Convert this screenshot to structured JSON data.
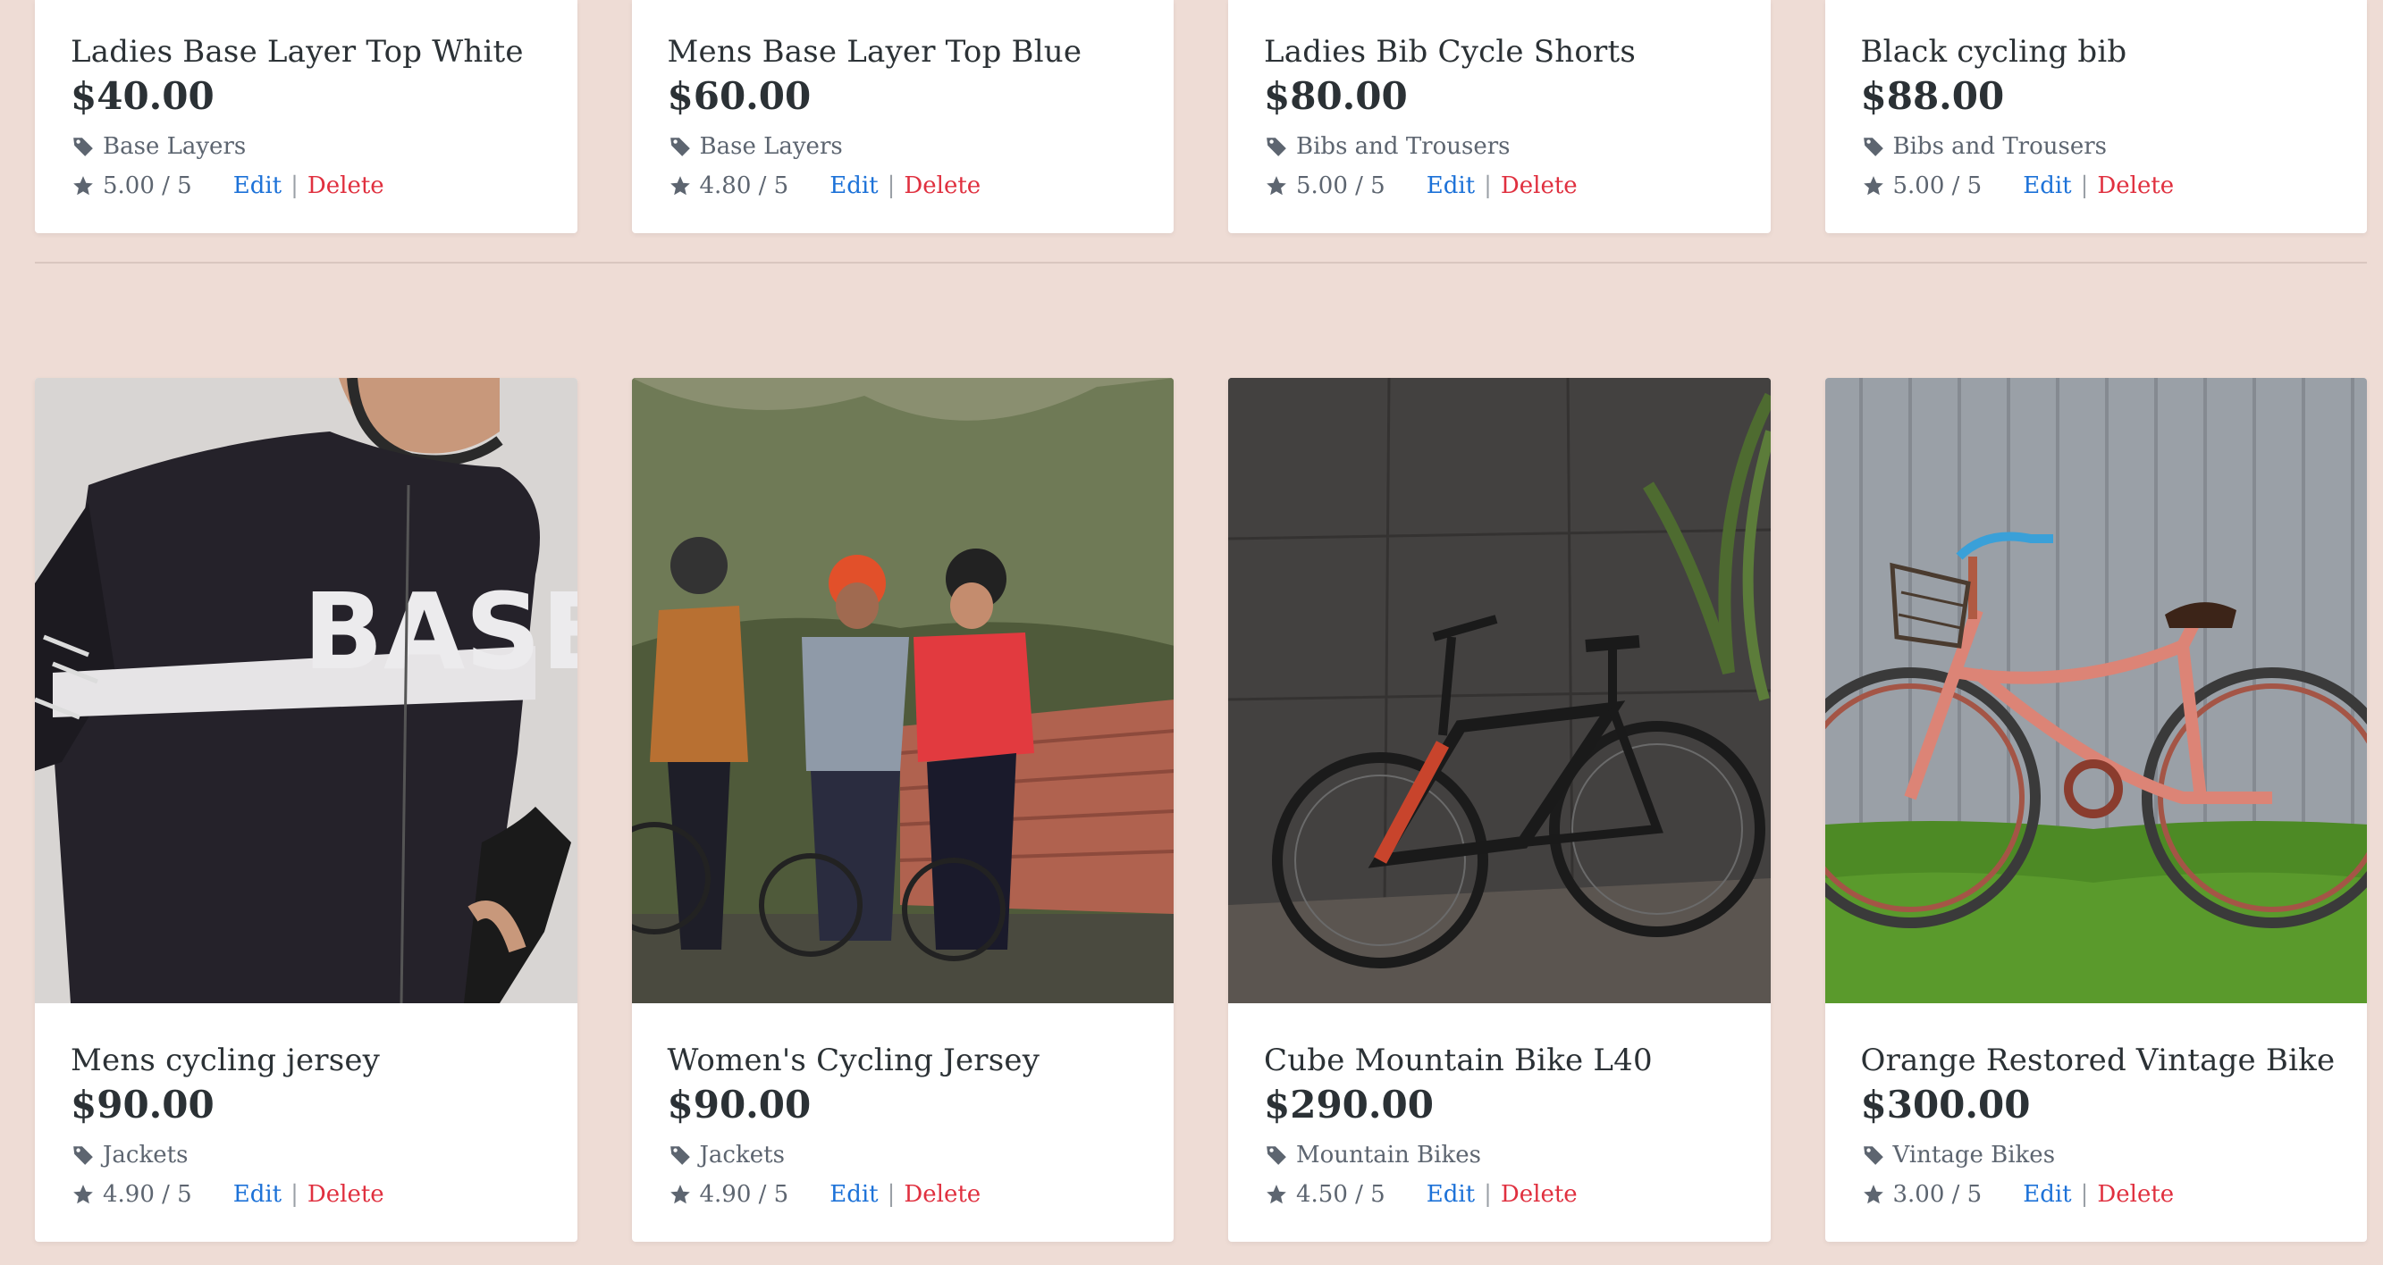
{
  "colors": {
    "background": "#eedcd5",
    "edit": "#1d72d8",
    "delete": "#e0303f",
    "text": "#2b3135",
    "muted": "#5d6570"
  },
  "top_products": [
    {
      "title": "Ladies Base Layer Top White",
      "price": "$40.00",
      "category": "Base Layers",
      "rating": "5.00 / 5",
      "edit": "Edit",
      "separator": "|",
      "delete": "Delete"
    },
    {
      "title": "Mens Base Layer Top Blue",
      "price": "$60.00",
      "category": "Base Layers",
      "rating": "4.80 / 5",
      "edit": "Edit",
      "separator": "|",
      "delete": "Delete"
    },
    {
      "title": "Ladies Bib Cycle Shorts",
      "price": "$80.00",
      "category": "Bibs and Trousers",
      "rating": "5.00 / 5",
      "edit": "Edit",
      "separator": "|",
      "delete": "Delete"
    },
    {
      "title": "Black cycling bib",
      "price": "$88.00",
      "category": "Bibs and Trousers",
      "rating": "5.00 / 5",
      "edit": "Edit",
      "separator": "|",
      "delete": "Delete"
    }
  ],
  "bottom_products": [
    {
      "title": "Mens cycling jersey",
      "price": "$90.00",
      "category": "Jackets",
      "rating": "4.90 / 5",
      "edit": "Edit",
      "separator": "|",
      "delete": "Delete",
      "image": "jersey-photo"
    },
    {
      "title": "Women's Cycling Jersey",
      "price": "$90.00",
      "category": "Jackets",
      "rating": "4.90 / 5",
      "edit": "Edit",
      "separator": "|",
      "delete": "Delete",
      "image": "cyclists-photo"
    },
    {
      "title": "Cube Mountain Bike L40",
      "price": "$290.00",
      "category": "Mountain Bikes",
      "rating": "4.50 / 5",
      "edit": "Edit",
      "separator": "|",
      "delete": "Delete",
      "image": "mountain-bike-photo"
    },
    {
      "title": "Orange Restored Vintage Bike",
      "price": "$300.00",
      "category": "Vintage Bikes",
      "rating": "3.00 / 5",
      "edit": "Edit",
      "separator": "|",
      "delete": "Delete",
      "image": "vintage-bike-photo"
    }
  ],
  "icons": {
    "category": "tag-icon",
    "rating": "star-icon"
  }
}
